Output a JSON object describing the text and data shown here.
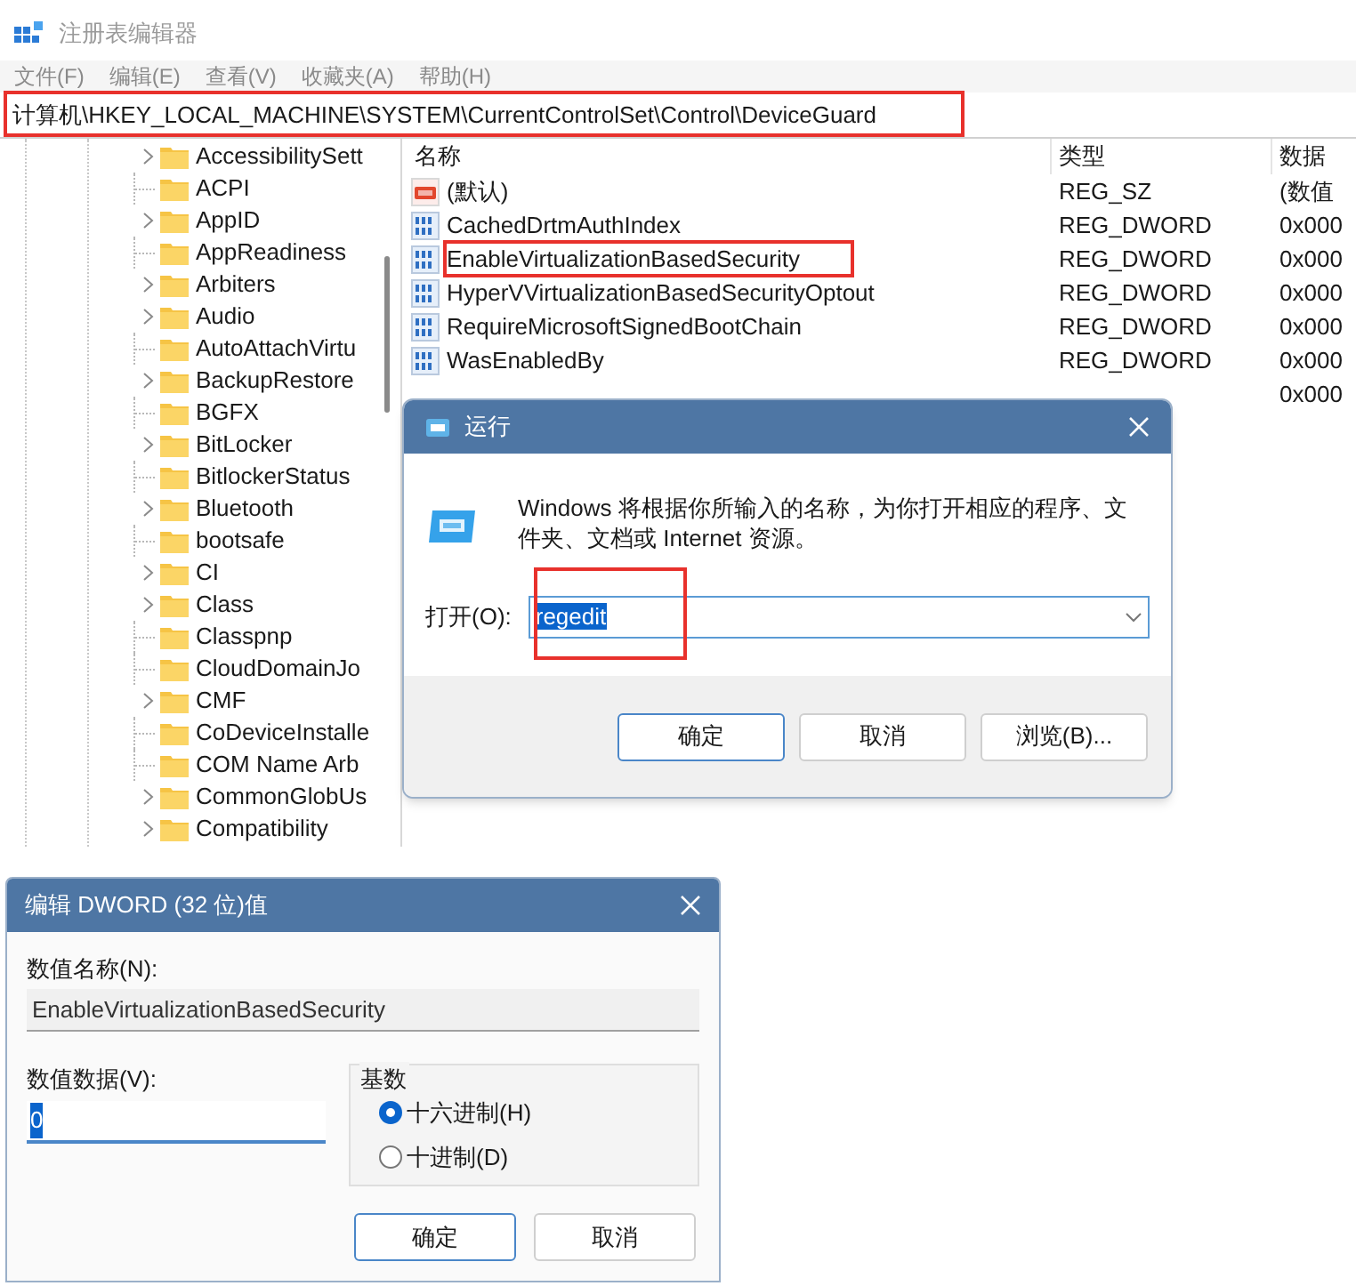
{
  "regedit": {
    "title": "注册表编辑器",
    "menu": [
      "文件(F)",
      "编辑(E)",
      "查看(V)",
      "收藏夹(A)",
      "帮助(H)"
    ],
    "address": {
      "text": "计算机\\HKEY_LOCAL_MACHINE\\SYSTEM\\CurrentControlSet\\Control\\DeviceGuard",
      "highlighted": true
    },
    "tree": [
      {
        "label": "AccessibilitySett",
        "expandable": true
      },
      {
        "label": "ACPI",
        "expandable": false
      },
      {
        "label": "AppID",
        "expandable": true
      },
      {
        "label": "AppReadiness",
        "expandable": false
      },
      {
        "label": "Arbiters",
        "expandable": true
      },
      {
        "label": "Audio",
        "expandable": true
      },
      {
        "label": "AutoAttachVirtu",
        "expandable": false
      },
      {
        "label": "BackupRestore",
        "expandable": true
      },
      {
        "label": "BGFX",
        "expandable": false
      },
      {
        "label": "BitLocker",
        "expandable": true
      },
      {
        "label": "BitlockerStatus",
        "expandable": false
      },
      {
        "label": "Bluetooth",
        "expandable": true
      },
      {
        "label": "bootsafe",
        "expandable": false
      },
      {
        "label": "CI",
        "expandable": true
      },
      {
        "label": "Class",
        "expandable": true
      },
      {
        "label": "Classpnp",
        "expandable": false
      },
      {
        "label": "CloudDomainJo",
        "expandable": false
      },
      {
        "label": "CMF",
        "expandable": true
      },
      {
        "label": "CoDeviceInstalle",
        "expandable": false
      },
      {
        "label": "COM Name Arb",
        "expandable": false
      },
      {
        "label": "CommonGlobUs",
        "expandable": true
      },
      {
        "label": "Compatibility",
        "expandable": true
      }
    ],
    "columns": [
      "名称",
      "类型",
      "数据"
    ],
    "values": [
      {
        "name": "(默认)",
        "kind": "string",
        "type": "REG_SZ",
        "data": "(数值",
        "highlighted": false
      },
      {
        "name": "CachedDrtmAuthIndex",
        "kind": "dword",
        "type": "REG_DWORD",
        "data": "0x000",
        "highlighted": false
      },
      {
        "name": "EnableVirtualizationBasedSecurity",
        "kind": "dword",
        "type": "REG_DWORD",
        "data": "0x000",
        "highlighted": true
      },
      {
        "name": "HyperVVirtualizationBasedSecurityOptout",
        "kind": "dword",
        "type": "REG_DWORD",
        "data": "0x000",
        "highlighted": false
      },
      {
        "name": "RequireMicrosoftSignedBootChain",
        "kind": "dword",
        "type": "REG_DWORD",
        "data": "0x000",
        "highlighted": false
      },
      {
        "name": "WasEnabledBy",
        "kind": "dword",
        "type": "REG_DWORD",
        "data": "0x000",
        "highlighted": false
      },
      {
        "data": "0x000"
      }
    ]
  },
  "run_dialog": {
    "title": "运行",
    "description": "Windows 将根据你所输入的名称，为你打开相应的程序、文件夹、文档或 Internet 资源。",
    "open_label": "打开(O):",
    "value": "regedit",
    "value_selected": true,
    "highlighted": true,
    "buttons": [
      "确定",
      "取消",
      "浏览(B)..."
    ]
  },
  "dword_dialog": {
    "title": "编辑 DWORD (32 位)值",
    "name_label": "数值名称(N):",
    "name_value": "EnableVirtualizationBasedSecurity",
    "data_label": "数值数据(V):",
    "data_value": "0",
    "value_selected": true,
    "base_label": "基数",
    "bases": [
      {
        "label": "十六进制(H)",
        "selected": true
      },
      {
        "label": "十进制(D)",
        "selected": false
      }
    ],
    "buttons": [
      "确定",
      "取消"
    ]
  }
}
